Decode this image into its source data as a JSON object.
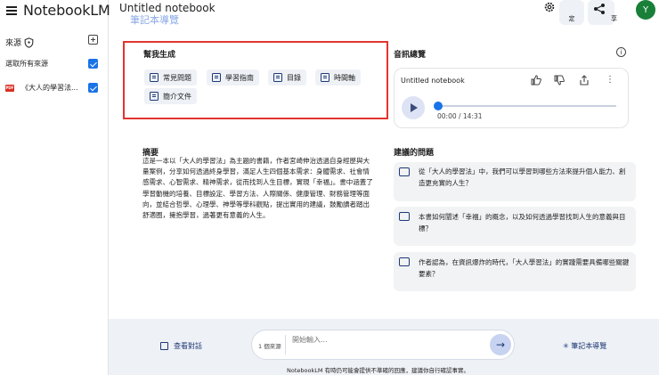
{
  "app": {
    "name": "NotebookLM"
  },
  "sidebar": {
    "sources_label": "來源",
    "select_all_label": "選取所有來源",
    "source_item": "《大人的學習法..."
  },
  "header": {
    "title": "Untitled notebook",
    "settings_label": "設\n定",
    "share_label": "享",
    "avatar_letter": "Y",
    "guide_partial": "筆記本導覽"
  },
  "help": {
    "title": "幫我生成",
    "chips": [
      "常見問題",
      "學習指南",
      "目錄",
      "時間軸",
      "簡介文件"
    ]
  },
  "summary": {
    "title": "摘要",
    "text": "這是一本以「大人的學習法」為主題的書籍，作者宮崎伸治透過自身經歷與大量案例，分享如何透過終身學習，滿足人生四個基本需求：身體需求、社會情感需求、心智需求、精神需求，從而找到人生目標，實現「幸福」。書中涵蓋了學習動機的培養、目標設定、學習方法、人際關係、健康管理、財務管理等面向，並結合哲學、心理學、神學等學科觀點，提出實用的建議，鼓勵讀者踏出舒適圈，擁抱學習，過著更有意義的人生。"
  },
  "audio": {
    "title": "音訊總覽",
    "notebook_name": "Untitled notebook",
    "time": "00:00 / 14:31",
    "progress": 0
  },
  "suggestions": {
    "title": "建議的問題",
    "items": [
      "從「大人的學習法」中，我們可以學習到哪些方法來提升個人能力、創造更充實的人生？",
      "本書如何闡述「幸福」的概念，以及如何透過學習找到人生的意義與目標？",
      "作者認為，在資訊爆炸的時代，「大人學習法」的實踐需要具備哪些關鍵要素？"
    ]
  },
  "footer": {
    "view_chat": "查看對話",
    "source_count": "1 個來源",
    "input_placeholder": "開始輸入...",
    "guide_button": "筆記本導覽",
    "disclaimer": "NotebookLM 有時仍可能會提供不準確的回應，建議你自行確認事實。"
  },
  "colors": {
    "accent": "#1a73e8",
    "highlight_border": "#e3342f",
    "avatar": "#188038"
  }
}
